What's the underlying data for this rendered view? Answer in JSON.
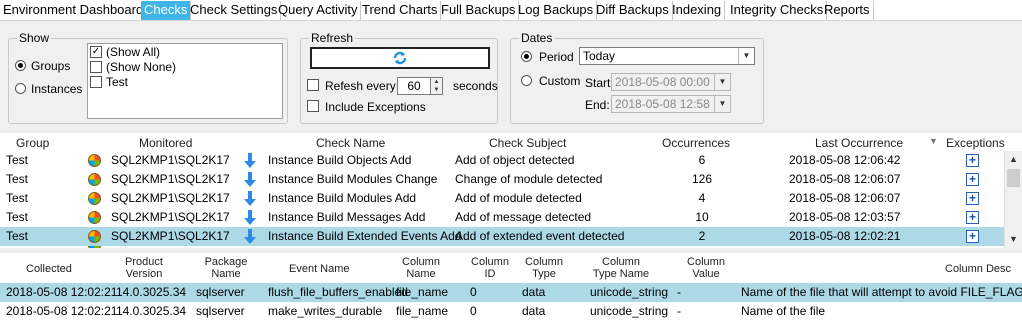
{
  "tabs": [
    {
      "label": "Environment Dashboard",
      "active": false
    },
    {
      "label": "Checks",
      "active": true
    },
    {
      "label": "Check Settings",
      "active": false
    },
    {
      "label": "Query Activity",
      "active": false
    },
    {
      "label": "Trend Charts",
      "active": false
    },
    {
      "label": "Full Backups",
      "active": false
    },
    {
      "label": "Log Backups",
      "active": false
    },
    {
      "label": "Diff Backups",
      "active": false
    },
    {
      "label": "Indexing",
      "active": false
    },
    {
      "label": "Integrity Checks",
      "active": false
    },
    {
      "label": "Reports",
      "active": false
    }
  ],
  "show": {
    "title": "Show",
    "groups_label": "Groups",
    "instances_label": "Instances",
    "selected": "Groups",
    "list": [
      {
        "label": "(Show All)",
        "checked": true
      },
      {
        "label": "(Show None)",
        "checked": false
      },
      {
        "label": "Test",
        "checked": false
      }
    ]
  },
  "refresh": {
    "title": "Refresh",
    "refresh_every_label": "Refesh every",
    "refresh_every_checked": false,
    "interval": "60",
    "seconds_label": "seconds",
    "include_exceptions_label": "Include Exceptions",
    "include_exceptions_checked": false
  },
  "dates": {
    "title": "Dates",
    "period_label": "Period",
    "custom_label": "Custom",
    "selected": "Period",
    "period_value": "Today",
    "start_label": "Start:",
    "start_value": "2018-05-08 00:00",
    "end_label": "End:",
    "end_value": "2018-05-08 12:58"
  },
  "checks_grid": {
    "headers": {
      "group": "Group",
      "monitored": "Monitored",
      "check_name": "Check Name",
      "check_subject": "Check Subject",
      "occurrences": "Occurrences",
      "last_occurrence": "Last Occurrence",
      "exceptions": "Exceptions"
    },
    "sort_column": "last_occurrence",
    "rows": [
      {
        "group": "Test",
        "monitored": "SQL2KMP1\\SQL2K17",
        "check_name": "Instance Build Objects Add",
        "check_subject": "Add of object detected",
        "occurrences": "6",
        "last_occurrence": "2018-05-08 12:06:42",
        "selected": false
      },
      {
        "group": "Test",
        "monitored": "SQL2KMP1\\SQL2K17",
        "check_name": "Instance Build Modules Change",
        "check_subject": "Change of module detected",
        "occurrences": "126",
        "last_occurrence": "2018-05-08 12:06:07",
        "selected": false
      },
      {
        "group": "Test",
        "monitored": "SQL2KMP1\\SQL2K17",
        "check_name": "Instance Build Modules Add",
        "check_subject": "Add of module detected",
        "occurrences": "4",
        "last_occurrence": "2018-05-08 12:06:07",
        "selected": false
      },
      {
        "group": "Test",
        "monitored": "SQL2KMP1\\SQL2K17",
        "check_name": "Instance Build Messages Add",
        "check_subject": "Add of message detected",
        "occurrences": "10",
        "last_occurrence": "2018-05-08 12:03:57",
        "selected": false
      },
      {
        "group": "Test",
        "monitored": "SQL2KMP1\\SQL2K17",
        "check_name": "Instance Build Extended Events Add",
        "check_subject": "Add of extended event detected",
        "occurrences": "2",
        "last_occurrence": "2018-05-08 12:02:21",
        "selected": true
      }
    ]
  },
  "details_grid": {
    "headers": {
      "collected": "Collected",
      "product_version": "Product Version",
      "package_name": "Package Name",
      "event_name": "Event Name",
      "column_name": "Column Name",
      "column_id": "Column ID",
      "column_type": "Column Type",
      "column_type_name": "Column Type Name",
      "column_value": "Column Value",
      "column_desc": "Column Desc"
    },
    "rows": [
      {
        "collected": "2018-05-08 12:02:21",
        "product_version": "14.0.3025.34",
        "package_name": "sqlserver",
        "event_name": "flush_file_buffers_enabled",
        "column_name": "file_name",
        "column_id": "0",
        "column_type": "data",
        "column_type_name": "unicode_string",
        "column_value": "-",
        "column_desc": "Name of the file that will attempt to avoid FILE_FLAG_WRITE_THROUGH",
        "selected": true
      },
      {
        "collected": "2018-05-08 12:02:21",
        "product_version": "14.0.3025.34",
        "package_name": "sqlserver",
        "event_name": "make_writes_durable",
        "column_name": "file_name",
        "column_id": "0",
        "column_type": "data",
        "column_type_name": "unicode_string",
        "column_value": "-",
        "column_desc": "Name of the file",
        "selected": false
      }
    ]
  },
  "colors": {
    "active_tab": "#3fb4e6",
    "selected_row": "#add8e6",
    "panel_bg": "#f0f0f0"
  },
  "icons": {
    "refresh": "refresh-icon",
    "instance": "windows-instance-icon",
    "trend": "down-arrow-icon",
    "exceptions": "plus-icon"
  }
}
